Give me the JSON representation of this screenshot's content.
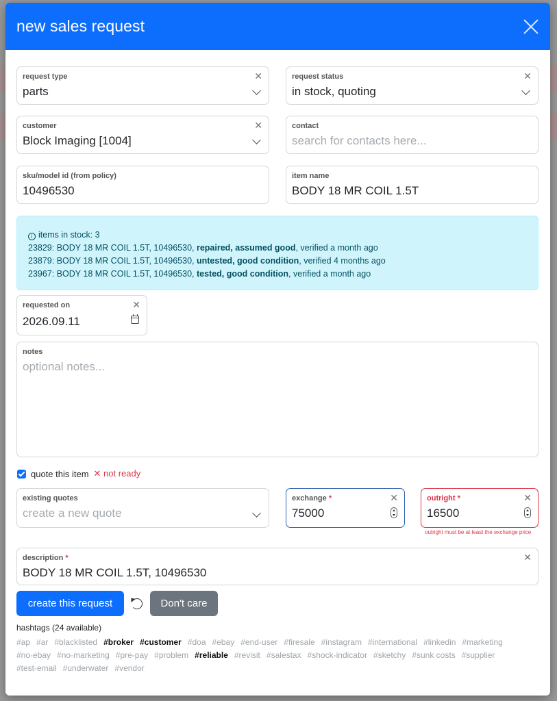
{
  "modal": {
    "title": "new sales request"
  },
  "fields": {
    "request_type": {
      "label": "request type",
      "value": "parts"
    },
    "request_status": {
      "label": "request status",
      "value": "in stock, quoting"
    },
    "customer": {
      "label": "customer",
      "value": "Block Imaging [1004]"
    },
    "contact": {
      "label": "contact",
      "placeholder": "search for contacts here..."
    },
    "sku": {
      "label": "sku/model id (from policy)",
      "value": "10496530"
    },
    "item_name": {
      "label": "item name",
      "value": "BODY 18 MR COIL 1.5T"
    },
    "requested_on": {
      "label": "requested on",
      "value": "2026.09.11"
    },
    "notes": {
      "label": "notes",
      "placeholder": "optional notes..."
    },
    "existing_quotes": {
      "label": "existing quotes",
      "placeholder": "create a new quote"
    },
    "exchange": {
      "label": "exchange",
      "required": "*",
      "value": "75000"
    },
    "outright": {
      "label": "outright",
      "required": "*",
      "value": "16500",
      "error": "outright must be at least the exchange price"
    },
    "description": {
      "label": "description",
      "required": "*",
      "value": "BODY 18 MR COIL 1.5T, 10496530"
    }
  },
  "stock": {
    "header": "items in stock: 3",
    "items": [
      {
        "prefix": "23829: BODY 18 MR COIL 1.5T, 10496530, ",
        "status": "repaired, assumed good",
        "suffix": ", verified a month ago"
      },
      {
        "prefix": "23879: BODY 18 MR COIL 1.5T, 10496530, ",
        "status": "untested, good condition",
        "suffix": ", verified 4 months ago"
      },
      {
        "prefix": "23967: BODY 18 MR COIL 1.5T, 10496530, ",
        "status": "tested, good condition",
        "suffix": ", verified a month ago"
      }
    ]
  },
  "quote": {
    "checkbox_label": "quote this item",
    "status": "✕ not ready"
  },
  "buttons": {
    "create": "create this request",
    "dont_care": "Don't care"
  },
  "hashtags": {
    "title": "hashtags (24 available)",
    "tags": [
      {
        "text": "#ap",
        "selected": false
      },
      {
        "text": "#ar",
        "selected": false
      },
      {
        "text": "#blacklisted",
        "selected": false
      },
      {
        "text": "#broker",
        "selected": true
      },
      {
        "text": "#customer",
        "selected": true
      },
      {
        "text": "#doa",
        "selected": false
      },
      {
        "text": "#ebay",
        "selected": false
      },
      {
        "text": "#end-user",
        "selected": false
      },
      {
        "text": "#firesale",
        "selected": false
      },
      {
        "text": "#instagram",
        "selected": false
      },
      {
        "text": "#international",
        "selected": false
      },
      {
        "text": "#linkedin",
        "selected": false
      },
      {
        "text": "#marketing",
        "selected": false
      },
      {
        "text": "#no-ebay",
        "selected": false
      },
      {
        "text": "#no-marketing",
        "selected": false
      },
      {
        "text": "#pre-pay",
        "selected": false
      },
      {
        "text": "#problem",
        "selected": false
      },
      {
        "text": "#reliable",
        "selected": true
      },
      {
        "text": "#revisit",
        "selected": false
      },
      {
        "text": "#salestax",
        "selected": false
      },
      {
        "text": "#shock-indicator",
        "selected": false
      },
      {
        "text": "#sketchy",
        "selected": false
      },
      {
        "text": "#sunk costs",
        "selected": false
      },
      {
        "text": "#supplier",
        "selected": false
      },
      {
        "text": "#test-email",
        "selected": false
      },
      {
        "text": "#underwater",
        "selected": false
      },
      {
        "text": "#vendor",
        "selected": false
      }
    ]
  },
  "colors": {
    "primary": "#0d6efd",
    "danger": "#dc3545",
    "info_bg": "#cff4fc",
    "secondary": "#6c757d"
  },
  "icons": {
    "close": "close-icon",
    "clear": "clear-icon",
    "chevron": "chevron-down-icon",
    "calendar": "calendar-icon",
    "spinner": "number-spinner-icon",
    "reset": "reset-icon",
    "info": "info-icon",
    "check": "checkbox-checked-icon"
  }
}
